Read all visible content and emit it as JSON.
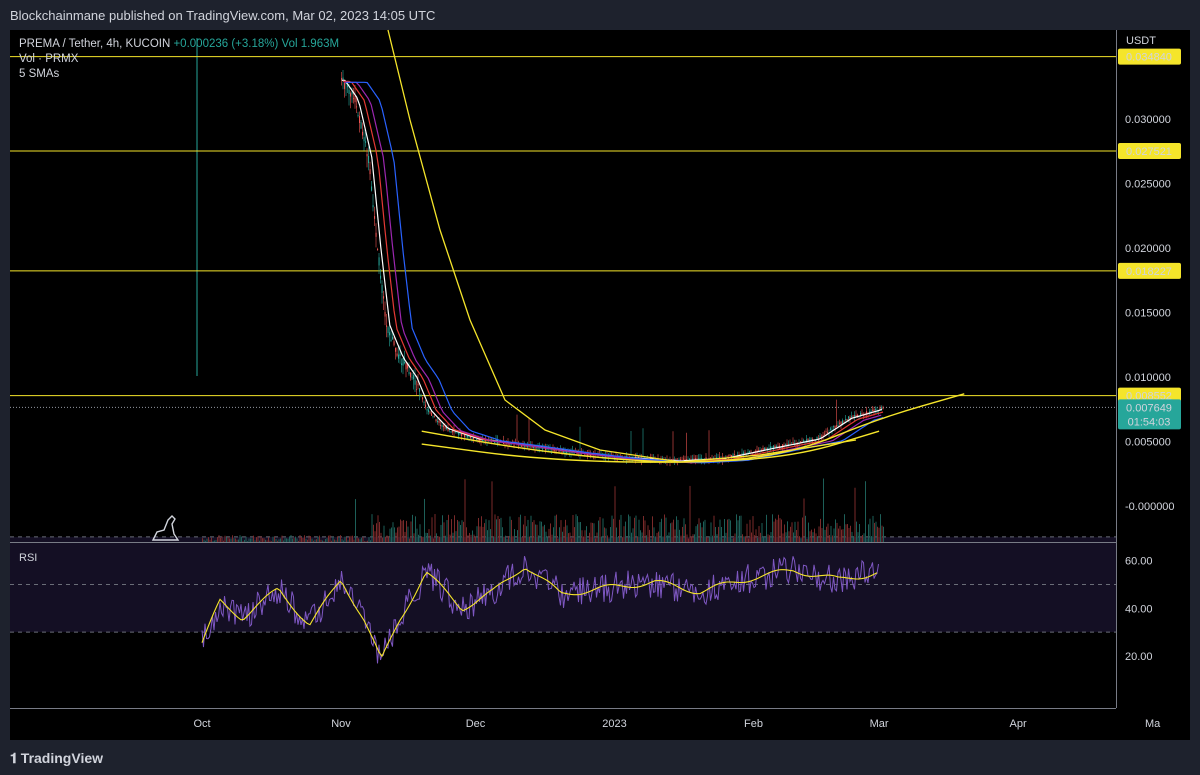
{
  "header": {
    "published": "Blockchainmane published on TradingView.com, Mar 02, 2023 14:05 UTC"
  },
  "legend": {
    "symbol": "PREMA / Tether, 4h, KUCOIN",
    "change": "+0.000236 (+3.18%)",
    "vol_value": "1.963M",
    "vol_label": "Vol · PRMX",
    "smas_label": "5 SMAs"
  },
  "footer": {
    "brand": "TradingView"
  },
  "colors": {
    "background": "#000000",
    "frame": "#1e222d",
    "level_line": "#f5e52a",
    "curve": "#f5e52a",
    "up": "#26a69a",
    "down": "#ef5350",
    "sma_white": "#ffffff",
    "sma_red": "#e53935",
    "sma_purple": "#9c27b0",
    "sma_blue": "#2962ff",
    "sma_yellow": "#f5e52a",
    "rsi_line": "#7e57c2",
    "rsi_ma": "#f5e52a"
  },
  "chart_data": [
    {
      "type": "candlestick",
      "axis_unit": "USDT",
      "x_ticks": [
        "Oct",
        "Nov",
        "Dec",
        "2023",
        "Feb",
        "Mar",
        "Apr",
        "Ma"
      ],
      "x_tick_dates": [
        "2022-10-01",
        "2022-11-01",
        "2022-12-01",
        "2023-01-01",
        "2023-02-01",
        "2023-03-01",
        "2023-04-01",
        "2023-05-01"
      ],
      "y_ticks": [
        {
          "value": 0.03,
          "label": "0.030000"
        },
        {
          "value": 0.025,
          "label": "0.025000"
        },
        {
          "value": 0.02,
          "label": "0.020000"
        },
        {
          "value": 0.015,
          "label": "0.015000"
        },
        {
          "value": 0.01,
          "label": "0.010000"
        },
        {
          "value": 0.005,
          "label": "0.005000"
        },
        {
          "value": 0.0,
          "label": "-0.000000"
        }
      ],
      "horizontal_levels": [
        {
          "value": 0.03484,
          "label": "0.034840"
        },
        {
          "value": 0.027521,
          "label": "0.027521"
        },
        {
          "value": 0.018227,
          "label": "0.018227"
        },
        {
          "value": 0.008552,
          "label": "0.008552"
        }
      ],
      "last_price": {
        "value": 0.007649,
        "label": "0.007649",
        "countdown": "01:54:03"
      },
      "price_path": [
        {
          "date": "2022-11-01",
          "value": 0.033
        },
        {
          "date": "2022-11-04",
          "value": 0.0315
        },
        {
          "date": "2022-11-07",
          "value": 0.027
        },
        {
          "date": "2022-11-09",
          "value": 0.02
        },
        {
          "date": "2022-11-11",
          "value": 0.014
        },
        {
          "date": "2022-11-14",
          "value": 0.0115
        },
        {
          "date": "2022-11-17",
          "value": 0.01
        },
        {
          "date": "2022-11-20",
          "value": 0.0075
        },
        {
          "date": "2022-11-24",
          "value": 0.006
        },
        {
          "date": "2022-12-01",
          "value": 0.0052
        },
        {
          "date": "2022-12-10",
          "value": 0.0048
        },
        {
          "date": "2022-12-20",
          "value": 0.0043
        },
        {
          "date": "2023-01-01",
          "value": 0.0038
        },
        {
          "date": "2023-01-15",
          "value": 0.0035
        },
        {
          "date": "2023-01-25",
          "value": 0.0037
        },
        {
          "date": "2023-02-05",
          "value": 0.0045
        },
        {
          "date": "2023-02-15",
          "value": 0.0052
        },
        {
          "date": "2023-02-22",
          "value": 0.0068
        },
        {
          "date": "2023-02-28",
          "value": 0.0074
        },
        {
          "date": "2023-03-02",
          "value": 0.007649
        }
      ],
      "rounding_curve": [
        {
          "date": "2022-11-19",
          "value": 0.0058
        },
        {
          "date": "2022-12-10",
          "value": 0.0045
        },
        {
          "date": "2023-01-01",
          "value": 0.0036
        },
        {
          "date": "2023-01-20",
          "value": 0.0033
        },
        {
          "date": "2023-02-10",
          "value": 0.0041
        },
        {
          "date": "2023-03-01",
          "value": 0.0068
        },
        {
          "date": "2023-03-20",
          "value": 0.0087
        }
      ],
      "lower_curve": [
        {
          "date": "2022-11-19",
          "value": 0.0048
        },
        {
          "date": "2022-12-15",
          "value": 0.0036
        },
        {
          "date": "2023-01-15",
          "value": 0.0033
        },
        {
          "date": "2023-02-10",
          "value": 0.0038
        },
        {
          "date": "2023-03-01",
          "value": 0.0058
        }
      ]
    },
    {
      "type": "line",
      "name": "RSI",
      "y_ticks": [
        {
          "value": 60,
          "label": "60.00"
        },
        {
          "value": 40,
          "label": "40.00"
        },
        {
          "value": 20,
          "label": "20.00"
        }
      ],
      "band_levels": [
        70,
        50,
        30
      ],
      "rsi_path": [
        {
          "date": "2022-10-01",
          "value": 25
        },
        {
          "date": "2022-10-05",
          "value": 43
        },
        {
          "date": "2022-10-10",
          "value": 36
        },
        {
          "date": "2022-10-18",
          "value": 48
        },
        {
          "date": "2022-10-25",
          "value": 33
        },
        {
          "date": "2022-11-01",
          "value": 52
        },
        {
          "date": "2022-11-06",
          "value": 36
        },
        {
          "date": "2022-11-10",
          "value": 18
        },
        {
          "date": "2022-11-14",
          "value": 35
        },
        {
          "date": "2022-11-20",
          "value": 55
        },
        {
          "date": "2022-11-28",
          "value": 40
        },
        {
          "date": "2022-12-05",
          "value": 47
        },
        {
          "date": "2022-12-12",
          "value": 58
        },
        {
          "date": "2022-12-20",
          "value": 46
        },
        {
          "date": "2023-01-01",
          "value": 49
        },
        {
          "date": "2023-01-10",
          "value": 51
        },
        {
          "date": "2023-01-20",
          "value": 47
        },
        {
          "date": "2023-02-01",
          "value": 53
        },
        {
          "date": "2023-02-10",
          "value": 56
        },
        {
          "date": "2023-02-20",
          "value": 52
        },
        {
          "date": "2023-03-01",
          "value": 55
        }
      ]
    }
  ]
}
